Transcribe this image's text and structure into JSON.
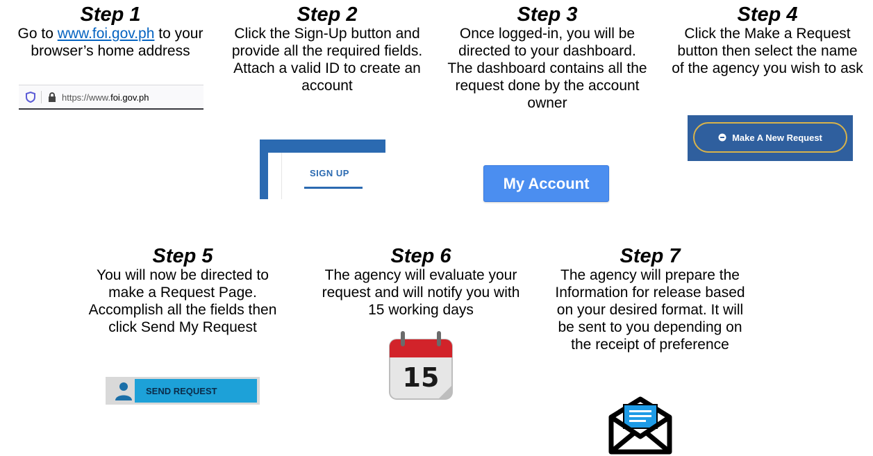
{
  "steps": [
    {
      "title": "Step 1",
      "text_before": "Go to ",
      "link": "www.foi.gov.ph",
      "text_after": " to your browser’s home address",
      "image": {
        "type": "browser-urlbar",
        "url_prefix": "https://www.",
        "url_domain": "foi.gov.ph"
      }
    },
    {
      "title": "Step 2",
      "text": "Click the Sign-Up button and provide all the required fields. Attach a valid ID to create an account",
      "image": {
        "type": "signup-tab",
        "label": "SIGN UP"
      }
    },
    {
      "title": "Step 3",
      "text": "Once logged-in, you will be directed to your dashboard.  The dashboard contains all the request done by the account owner",
      "image": {
        "type": "button",
        "label": "My Account"
      }
    },
    {
      "title": "Step 4",
      "text": "Click the Make a Request button then select the name of the agency you wish to ask",
      "image": {
        "type": "button",
        "label": "Make A New Request"
      }
    },
    {
      "title": "Step 5",
      "text": "You will now be directed to make a Request Page.  Accomplish all the fields then click Send My Request",
      "image": {
        "type": "button",
        "label": "SEND REQUEST"
      }
    },
    {
      "title": "Step 6",
      "text": "The agency will evaluate your request and will notify you with 15 working days",
      "image": {
        "type": "calendar",
        "day": "15"
      }
    },
    {
      "title": "Step 7",
      "text": "The agency will prepare the Information for release based on your desired format.  It will be sent to you depending on the receipt of preference",
      "image": {
        "type": "envelope-icon"
      }
    }
  ],
  "colors": {
    "link": "#0563C1",
    "accent_blue": "#2b6ab1",
    "button_blue": "#4b8ef0",
    "send_blue": "#1da1d8",
    "gold": "#d9b34a"
  }
}
